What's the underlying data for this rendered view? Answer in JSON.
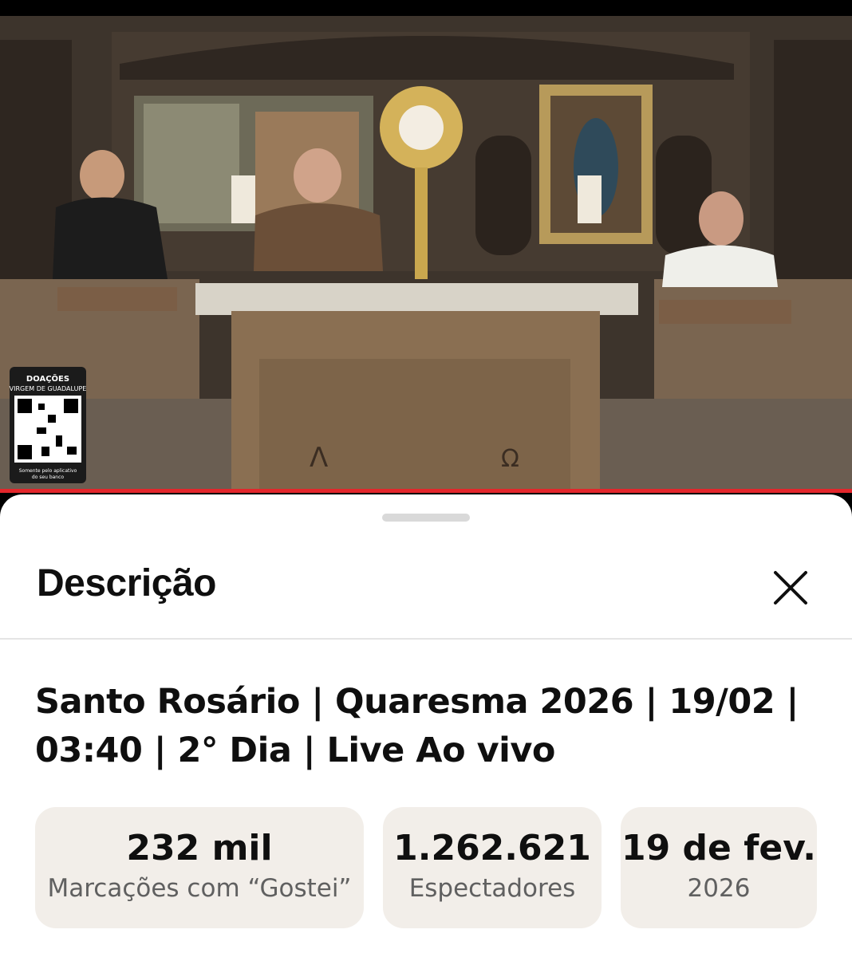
{
  "video": {
    "overlay": {
      "line1": "DOAÇÕES",
      "line2": "VIRGEM DE GUADALUPE",
      "line3": "Somente pelo aplicativo",
      "line4": "do seu banco"
    },
    "symbols": {
      "alpha": "Λ",
      "omega": "Ω"
    },
    "progress_color": "#e3262b"
  },
  "sheet": {
    "title": "Descrição",
    "close_icon": "close-icon"
  },
  "description": {
    "title_line1": "Santo Rosário | Quaresma 2026 | 19/02 |",
    "title_line2": "03:40 | 2° Dia | Live Ao vivo"
  },
  "stats": {
    "likes": {
      "value": "232 mil",
      "label": "Marcações com “Gostei”"
    },
    "views": {
      "value": "1.262.621",
      "label": "Espectadores"
    },
    "date": {
      "value": "19 de fev.",
      "label": "2026"
    }
  }
}
